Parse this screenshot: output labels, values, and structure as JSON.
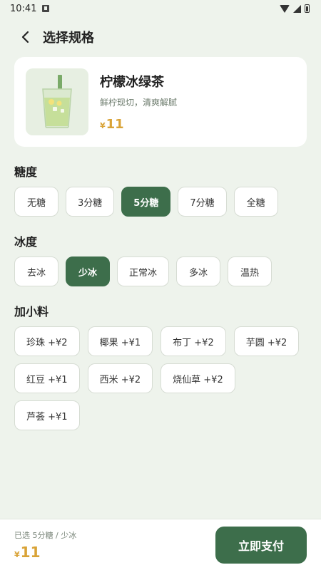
{
  "status_bar": {
    "time": "10:41"
  },
  "header": {
    "title": "选择规格"
  },
  "product": {
    "name": "柠檬冰绿茶",
    "description": "鲜柠现切，清爽解腻",
    "currency": "¥",
    "price": "11"
  },
  "sugar": {
    "title": "糖度",
    "options": [
      "无糖",
      "3分糖",
      "5分糖",
      "7分糖",
      "全糖"
    ],
    "selected_index": 2
  },
  "ice": {
    "title": "冰度",
    "options": [
      "去冰",
      "少冰",
      "正常冰",
      "多冰",
      "温热"
    ],
    "selected_index": 1
  },
  "toppings": {
    "title": "加小料",
    "options": [
      "珍珠 +¥2",
      "椰果 +¥1",
      "布丁 +¥2",
      "芋圆 +¥2",
      "红豆 +¥1",
      "西米 +¥2",
      "烧仙草 +¥2",
      "芦荟 +¥1"
    ]
  },
  "bottom": {
    "summary": "已选 5分糖 / 少冰",
    "currency": "¥",
    "price": "11",
    "pay_label": "立即支付"
  },
  "colors": {
    "accent": "#3d6e4b",
    "price": "#d9a337",
    "background": "#eef3ec"
  }
}
